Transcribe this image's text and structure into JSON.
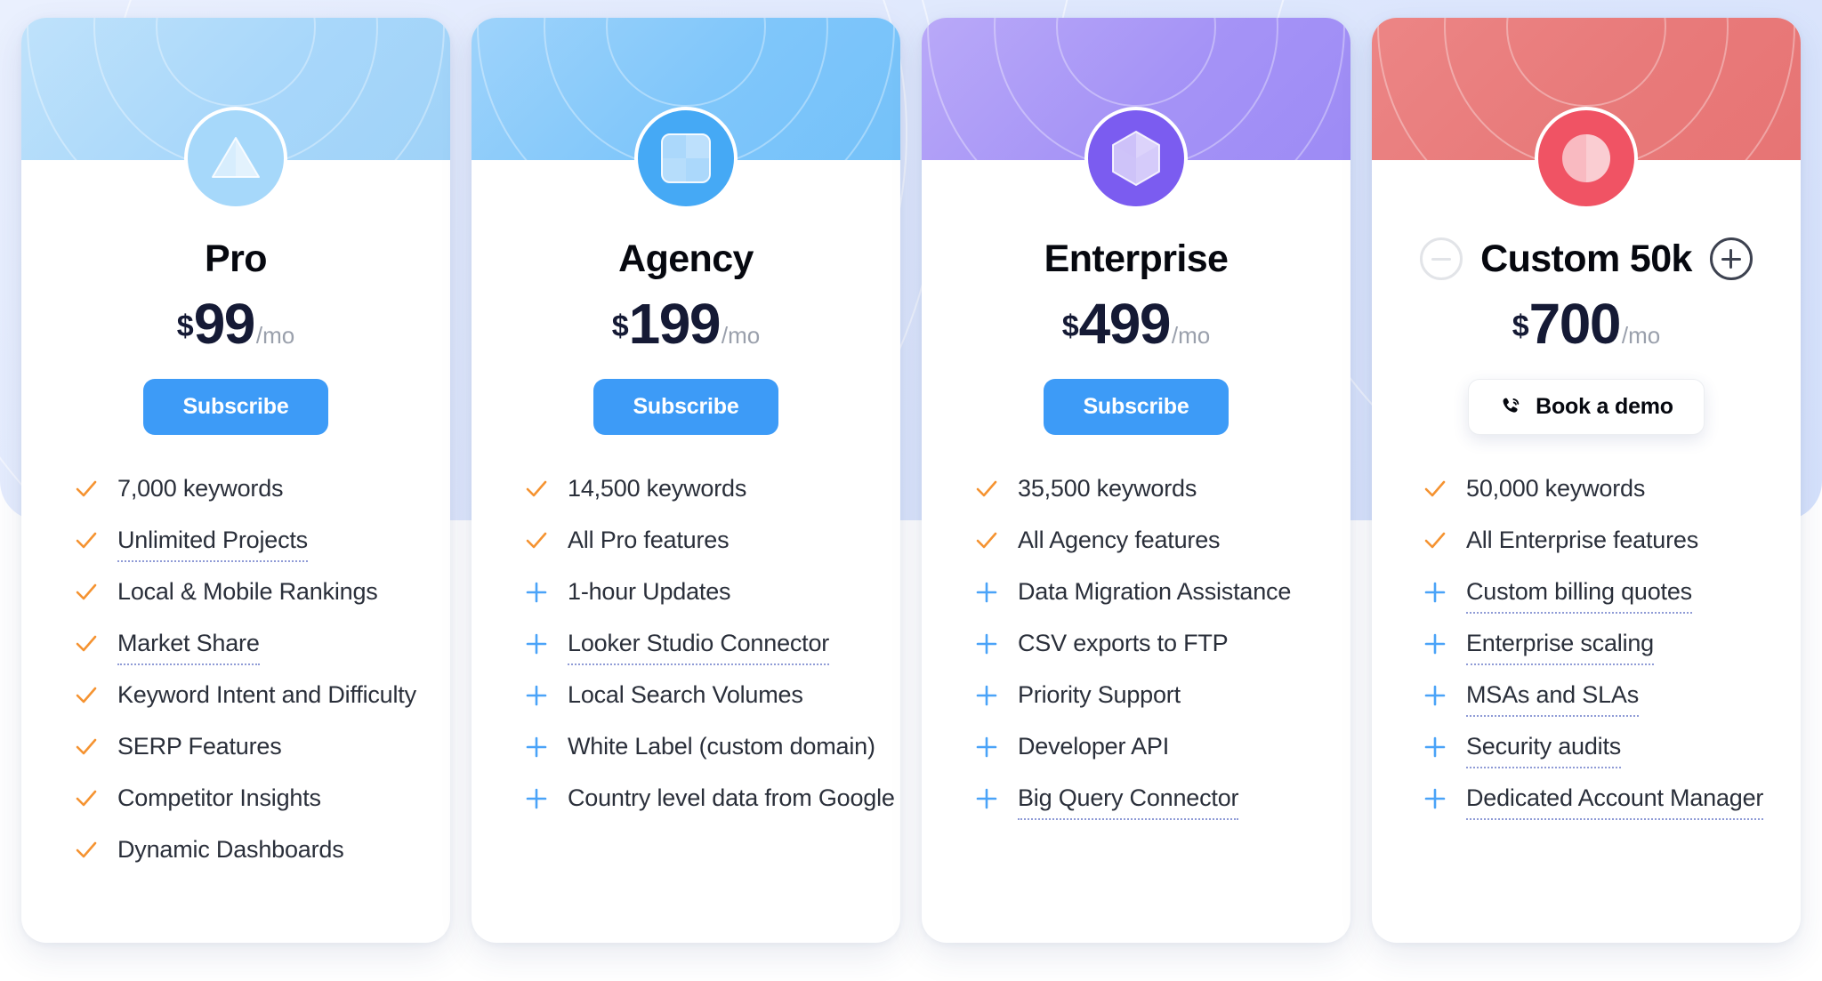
{
  "colors": {
    "accent_blue": "#3d9bf7",
    "check_orange": "#f59331",
    "plus_blue": "#4aa3f8",
    "price_navy": "#151a35",
    "per_gray": "#9aa0ac",
    "tooltip_dotted": "#8f9bd6"
  },
  "plans": [
    {
      "id": "pro",
      "name": "Pro",
      "icon": "triangle-icon",
      "currency": "$",
      "price": "99",
      "period": "/mo",
      "cta": {
        "type": "subscribe",
        "label": "Subscribe"
      },
      "features": [
        {
          "icon": "check",
          "label": "7,000 keywords",
          "tooltip": false
        },
        {
          "icon": "check",
          "label": "Unlimited Projects",
          "tooltip": true
        },
        {
          "icon": "check",
          "label": "Local & Mobile Rankings",
          "tooltip": false
        },
        {
          "icon": "check",
          "label": "Market Share",
          "tooltip": true
        },
        {
          "icon": "check",
          "label": "Keyword Intent and Difficulty",
          "tooltip": false
        },
        {
          "icon": "check",
          "label": "SERP Features",
          "tooltip": false
        },
        {
          "icon": "check",
          "label": "Competitor Insights",
          "tooltip": false
        },
        {
          "icon": "check",
          "label": "Dynamic Dashboards",
          "tooltip": false
        }
      ]
    },
    {
      "id": "agency",
      "name": "Agency",
      "icon": "squares-icon",
      "currency": "$",
      "price": "199",
      "period": "/mo",
      "cta": {
        "type": "subscribe",
        "label": "Subscribe"
      },
      "features": [
        {
          "icon": "check",
          "label": "14,500 keywords",
          "tooltip": false
        },
        {
          "icon": "check",
          "label": "All Pro features",
          "tooltip": false
        },
        {
          "icon": "plus",
          "label": "1-hour Updates",
          "tooltip": false
        },
        {
          "icon": "plus",
          "label": "Looker Studio Connector",
          "tooltip": true
        },
        {
          "icon": "plus",
          "label": "Local Search Volumes",
          "tooltip": false
        },
        {
          "icon": "plus",
          "label": "White Label (custom domain)",
          "tooltip": false
        },
        {
          "icon": "plus",
          "label": "Country level data from Google",
          "tooltip": false
        }
      ]
    },
    {
      "id": "enterprise",
      "name": "Enterprise",
      "icon": "cube-icon",
      "currency": "$",
      "price": "499",
      "period": "/mo",
      "cta": {
        "type": "subscribe",
        "label": "Subscribe"
      },
      "features": [
        {
          "icon": "check",
          "label": "35,500 keywords",
          "tooltip": false
        },
        {
          "icon": "check",
          "label": "All Agency features",
          "tooltip": false
        },
        {
          "icon": "plus",
          "label": "Data Migration Assistance",
          "tooltip": false
        },
        {
          "icon": "plus",
          "label": "CSV exports to FTP",
          "tooltip": false
        },
        {
          "icon": "plus",
          "label": "Priority Support",
          "tooltip": false
        },
        {
          "icon": "plus",
          "label": "Developer API",
          "tooltip": false
        },
        {
          "icon": "plus",
          "label": "Big Query Connector",
          "tooltip": true
        }
      ]
    },
    {
      "id": "custom",
      "name": "Custom 50k",
      "icon": "circle-icon",
      "currency": "$",
      "price": "700",
      "period": "/mo",
      "stepper": {
        "decrement": "−",
        "increment": "+",
        "decrement_disabled": true
      },
      "cta": {
        "type": "demo",
        "label": "Book a demo",
        "icon": "phone-icon"
      },
      "features": [
        {
          "icon": "check",
          "label": "50,000 keywords",
          "tooltip": false
        },
        {
          "icon": "check",
          "label": "All Enterprise features",
          "tooltip": false
        },
        {
          "icon": "plus",
          "label": "Custom billing quotes",
          "tooltip": true
        },
        {
          "icon": "plus",
          "label": "Enterprise scaling",
          "tooltip": true
        },
        {
          "icon": "plus",
          "label": "MSAs and SLAs",
          "tooltip": true
        },
        {
          "icon": "plus",
          "label": "Security audits",
          "tooltip": true
        },
        {
          "icon": "plus",
          "label": "Dedicated Account Manager",
          "tooltip": true
        }
      ]
    }
  ]
}
